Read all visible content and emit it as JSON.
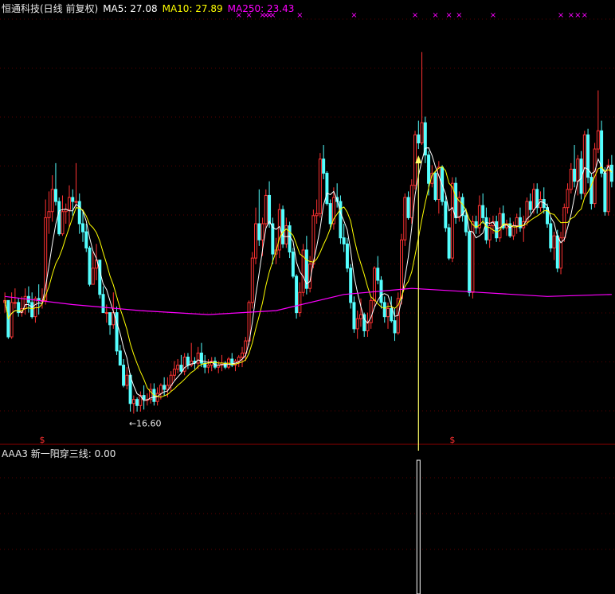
{
  "header": {
    "stock_label": "恒通科技(日线 前复权)",
    "ma5": "MA5: 27.08",
    "ma10": "MA10: 27.89",
    "ma250": "MA250: 23.43"
  },
  "indicator_panel": {
    "label": "AAA3",
    "signal_text": "新一阳穿三线: 0.00"
  },
  "colors": {
    "up": "#ff3232",
    "down": "#54ffff",
    "ma5": "#ffffff",
    "ma10": "#ffff00",
    "ma250": "#ff00ff",
    "signal_arrow": "#ffff66",
    "grid": "#8b0000"
  },
  "chart_data": {
    "type": "candlestick",
    "low_annotation": "16.60",
    "top_markers": "×",
    "bottom_markers": "$",
    "candles": [
      [
        22.1,
        22.6,
        21.6,
        22.2
      ],
      [
        22.2,
        22.2,
        20.3,
        20.4
      ],
      [
        20.4,
        22.6,
        20.3,
        22.1
      ],
      [
        22.1,
        22.8,
        21.8,
        22.1
      ],
      [
        22.1,
        22.3,
        21.4,
        21.6
      ],
      [
        21.6,
        22.4,
        21.4,
        21.8
      ],
      [
        21.8,
        22.8,
        21.5,
        22.4
      ],
      [
        22.4,
        22.9,
        21.6,
        22.1
      ],
      [
        22.1,
        22.6,
        21.3,
        21.4
      ],
      [
        21.4,
        22.4,
        21.1,
        22.3
      ],
      [
        22.3,
        23.0,
        21.5,
        22.2
      ],
      [
        22.2,
        22.8,
        21.8,
        22.2
      ],
      [
        22.2,
        27.2,
        22.0,
        26.3
      ],
      [
        26.3,
        27.6,
        25.5,
        26.6
      ],
      [
        26.6,
        28.4,
        26.1,
        27.7
      ],
      [
        27.7,
        29.0,
        26.9,
        27.1
      ],
      [
        27.1,
        27.3,
        25.4,
        25.5
      ],
      [
        25.5,
        27.4,
        25.4,
        26.6
      ],
      [
        26.6,
        27.0,
        26.0,
        26.7
      ],
      [
        26.7,
        27.9,
        25.8,
        27.3
      ],
      [
        27.3,
        27.7,
        26.4,
        27.1
      ],
      [
        27.1,
        29.0,
        26.8,
        27.1
      ],
      [
        27.1,
        27.5,
        25.5,
        26.0
      ],
      [
        26.0,
        26.7,
        25.1,
        25.6
      ],
      [
        25.6,
        26.0,
        24.6,
        24.8
      ],
      [
        24.8,
        24.9,
        22.9,
        23.0
      ],
      [
        23.0,
        24.6,
        23.0,
        23.8
      ],
      [
        23.8,
        25.0,
        23.2,
        24.2
      ],
      [
        24.2,
        24.2,
        22.3,
        22.5
      ],
      [
        22.5,
        22.9,
        21.6,
        21.6
      ],
      [
        21.6,
        22.0,
        21.1,
        21.6
      ],
      [
        21.6,
        21.6,
        20.5,
        21.0
      ],
      [
        21.0,
        22.6,
        20.8,
        21.6
      ],
      [
        21.6,
        21.9,
        19.5,
        19.7
      ],
      [
        19.7,
        20.0,
        19.0,
        19.0
      ],
      [
        19.0,
        19.3,
        17.9,
        18.0
      ],
      [
        18.0,
        18.9,
        17.8,
        18.5
      ],
      [
        18.5,
        18.6,
        16.7,
        17.1
      ],
      [
        17.1,
        17.5,
        16.6,
        17.3
      ],
      [
        17.3,
        17.4,
        16.7,
        17.0
      ],
      [
        17.0,
        17.7,
        16.7,
        17.5
      ],
      [
        17.5,
        18.0,
        16.8,
        17.3
      ],
      [
        17.3,
        17.6,
        17.0,
        17.3
      ],
      [
        17.3,
        18.1,
        17.1,
        17.8
      ],
      [
        17.8,
        18.1,
        17.0,
        17.2
      ],
      [
        17.2,
        17.9,
        17.0,
        17.6
      ],
      [
        17.6,
        18.1,
        17.3,
        18.0
      ],
      [
        18.0,
        18.4,
        17.5,
        17.8
      ],
      [
        17.8,
        18.4,
        17.4,
        18.0
      ],
      [
        18.0,
        18.7,
        17.7,
        18.5
      ],
      [
        18.5,
        19.2,
        18.2,
        18.8
      ],
      [
        18.8,
        19.3,
        18.6,
        19.0
      ],
      [
        19.0,
        19.5,
        18.6,
        18.7
      ],
      [
        18.7,
        19.6,
        18.5,
        19.4
      ],
      [
        19.4,
        19.6,
        18.8,
        19.0
      ],
      [
        19.0,
        20.1,
        18.9,
        19.2
      ],
      [
        19.2,
        19.4,
        18.8,
        19.1
      ],
      [
        19.1,
        19.9,
        18.8,
        19.6
      ],
      [
        19.6,
        20.1,
        18.9,
        19.1
      ],
      [
        19.1,
        19.5,
        18.6,
        18.9
      ],
      [
        18.9,
        19.3,
        18.6,
        19.0
      ],
      [
        19.0,
        19.4,
        18.7,
        19.2
      ],
      [
        19.2,
        19.4,
        18.8,
        18.9
      ],
      [
        18.9,
        19.2,
        18.6,
        19.0
      ],
      [
        19.0,
        19.5,
        18.7,
        19.1
      ],
      [
        19.1,
        19.2,
        18.8,
        18.9
      ],
      [
        18.9,
        19.4,
        18.8,
        19.3
      ],
      [
        19.3,
        19.6,
        18.9,
        19.0
      ],
      [
        19.0,
        19.3,
        18.7,
        19.2
      ],
      [
        19.2,
        19.5,
        18.9,
        19.4
      ],
      [
        19.4,
        19.9,
        18.9,
        19.6
      ],
      [
        19.6,
        20.4,
        19.2,
        20.2
      ],
      [
        20.2,
        22.2,
        20.0,
        22.1
      ],
      [
        22.1,
        24.6,
        21.8,
        24.3
      ],
      [
        24.3,
        26.8,
        24.0,
        26.0
      ],
      [
        26.0,
        27.7,
        24.9,
        25.2
      ],
      [
        25.2,
        26.3,
        24.4,
        26.0
      ],
      [
        26.0,
        27.7,
        25.8,
        27.4
      ],
      [
        27.4,
        28.1,
        25.8,
        26.0
      ],
      [
        26.0,
        26.3,
        24.0,
        24.5
      ],
      [
        24.5,
        25.3,
        24.0,
        24.7
      ],
      [
        24.7,
        27.0,
        24.3,
        26.7
      ],
      [
        26.7,
        26.9,
        24.8,
        25.0
      ],
      [
        25.0,
        26.3,
        24.8,
        25.9
      ],
      [
        25.9,
        26.1,
        24.3,
        24.6
      ],
      [
        24.6,
        24.8,
        23.3,
        23.4
      ],
      [
        23.4,
        23.5,
        21.3,
        21.6
      ],
      [
        21.6,
        23.1,
        21.4,
        22.6
      ],
      [
        22.6,
        25.0,
        22.4,
        24.7
      ],
      [
        24.7,
        25.4,
        22.5,
        22.8
      ],
      [
        22.8,
        24.4,
        22.6,
        24.0
      ],
      [
        24.0,
        26.7,
        23.8,
        26.4
      ],
      [
        26.4,
        27.2,
        26.0,
        26.5
      ],
      [
        26.5,
        29.5,
        26.3,
        29.2
      ],
      [
        29.2,
        29.9,
        28.2,
        28.5
      ],
      [
        28.5,
        28.6,
        26.9,
        27.0
      ],
      [
        27.0,
        27.2,
        25.7,
        26.0
      ],
      [
        26.0,
        27.8,
        25.7,
        27.3
      ],
      [
        27.3,
        28.0,
        26.8,
        27.1
      ],
      [
        27.1,
        27.4,
        25.0,
        25.3
      ],
      [
        25.3,
        26.0,
        24.6,
        25.0
      ],
      [
        25.0,
        25.3,
        23.6,
        23.8
      ],
      [
        23.8,
        24.0,
        21.8,
        22.1
      ],
      [
        22.1,
        22.4,
        20.6,
        20.8
      ],
      [
        20.8,
        21.7,
        20.3,
        21.3
      ],
      [
        21.3,
        22.3,
        20.9,
        21.5
      ],
      [
        21.5,
        21.6,
        20.4,
        20.7
      ],
      [
        20.7,
        21.6,
        20.4,
        21.1
      ],
      [
        21.1,
        22.4,
        20.8,
        22.2
      ],
      [
        22.2,
        23.9,
        21.9,
        23.8
      ],
      [
        23.8,
        24.4,
        23.0,
        23.2
      ],
      [
        23.2,
        23.4,
        21.8,
        22.1
      ],
      [
        22.1,
        22.4,
        21.1,
        21.4
      ],
      [
        21.4,
        22.1,
        20.8,
        21.8
      ],
      [
        21.8,
        22.4,
        21.1,
        21.2
      ],
      [
        21.2,
        21.8,
        20.2,
        20.6
      ],
      [
        20.6,
        22.6,
        20.5,
        22.3
      ],
      [
        22.3,
        25.5,
        22.0,
        25.2
      ],
      [
        25.2,
        27.5,
        24.9,
        27.3
      ],
      [
        27.3,
        27.6,
        26.2,
        26.3
      ],
      [
        26.3,
        28.2,
        26.0,
        27.9
      ],
      [
        27.9,
        30.6,
        27.7,
        30.4
      ],
      [
        30.4,
        31.1,
        29.7,
        30.0
      ],
      [
        30.0,
        34.5,
        29.9,
        31.0
      ],
      [
        31.0,
        31.3,
        29.0,
        29.4
      ],
      [
        29.4,
        29.6,
        27.4,
        28.0
      ],
      [
        28.0,
        28.9,
        27.8,
        28.5
      ],
      [
        28.5,
        28.6,
        27.1,
        27.2
      ],
      [
        27.2,
        29.1,
        26.5,
        28.8
      ],
      [
        28.8,
        28.9,
        26.9,
        27.1
      ],
      [
        27.1,
        27.4,
        25.6,
        25.8
      ],
      [
        25.8,
        26.0,
        24.2,
        24.3
      ],
      [
        24.3,
        28.3,
        24.1,
        28.0
      ],
      [
        28.0,
        28.3,
        26.0,
        26.3
      ],
      [
        26.3,
        27.6,
        26.1,
        27.3
      ],
      [
        27.3,
        27.5,
        26.1,
        26.4
      ],
      [
        26.4,
        26.7,
        25.4,
        25.6
      ],
      [
        25.6,
        25.7,
        22.4,
        22.6
      ],
      [
        22.6,
        26.4,
        22.3,
        26.1
      ],
      [
        26.1,
        26.4,
        25.5,
        25.8
      ],
      [
        25.8,
        27.4,
        25.5,
        26.9
      ],
      [
        26.9,
        27.5,
        26.0,
        26.3
      ],
      [
        26.3,
        26.8,
        25.0,
        25.2
      ],
      [
        25.2,
        26.3,
        24.8,
        25.9
      ],
      [
        25.9,
        26.4,
        25.5,
        26.1
      ],
      [
        26.1,
        26.4,
        25.1,
        25.3
      ],
      [
        25.3,
        26.8,
        25.1,
        26.5
      ],
      [
        26.5,
        26.9,
        25.7,
        25.8
      ],
      [
        25.8,
        26.2,
        25.4,
        26.0
      ],
      [
        26.0,
        26.3,
        25.3,
        25.4
      ],
      [
        25.4,
        26.1,
        25.2,
        25.9
      ],
      [
        25.9,
        26.5,
        25.5,
        26.3
      ],
      [
        26.3,
        26.8,
        25.6,
        25.8
      ],
      [
        25.8,
        26.4,
        25.1,
        26.1
      ],
      [
        26.1,
        27.3,
        25.9,
        27.1
      ],
      [
        27.1,
        27.5,
        26.5,
        26.7
      ],
      [
        26.7,
        28.0,
        26.5,
        27.7
      ],
      [
        27.7,
        28.0,
        26.5,
        26.8
      ],
      [
        26.8,
        27.6,
        26.6,
        27.2
      ],
      [
        27.2,
        27.8,
        26.5,
        26.8
      ],
      [
        26.8,
        27.0,
        25.8,
        26.0
      ],
      [
        26.0,
        26.3,
        24.6,
        24.8
      ],
      [
        24.8,
        25.6,
        24.2,
        25.4
      ],
      [
        25.4,
        25.7,
        23.6,
        23.8
      ],
      [
        23.8,
        25.6,
        23.5,
        25.3
      ],
      [
        25.3,
        27.0,
        25.1,
        26.8
      ],
      [
        26.8,
        28.0,
        26.5,
        27.7
      ],
      [
        27.7,
        29.0,
        27.5,
        28.7
      ],
      [
        28.7,
        29.9,
        27.8,
        28.1
      ],
      [
        28.1,
        29.4,
        27.4,
        29.2
      ],
      [
        29.2,
        29.6,
        27.2,
        27.5
      ],
      [
        27.5,
        30.6,
        27.3,
        30.4
      ],
      [
        30.4,
        30.7,
        28.0,
        28.3
      ],
      [
        28.3,
        28.5,
        26.7,
        27.0
      ],
      [
        27.0,
        30.0,
        26.8,
        29.7
      ],
      [
        29.7,
        32.6,
        29.5,
        30.6
      ],
      [
        30.6,
        31.1,
        28.3,
        28.5
      ],
      [
        28.5,
        28.8,
        26.4,
        26.6
      ],
      [
        26.6,
        29.2,
        26.4,
        28.9
      ],
      [
        28.9,
        29.4,
        27.8,
        28.1
      ]
    ],
    "ma250_points": [
      [
        0,
        22.4
      ],
      [
        20,
        22.0
      ],
      [
        40,
        21.7
      ],
      [
        60,
        21.5
      ],
      [
        80,
        21.7
      ],
      [
        100,
        22.5
      ],
      [
        120,
        22.8
      ],
      [
        140,
        22.6
      ],
      [
        160,
        22.4
      ],
      [
        179,
        22.5
      ]
    ],
    "signal_index": 122,
    "low_index": 38,
    "bottom_marker_indices": [
      11,
      132
    ],
    "top_marker_indices": [
      69,
      72,
      76,
      77,
      78,
      79,
      87,
      103,
      121,
      127,
      131,
      134,
      144,
      164,
      167,
      169,
      171
    ]
  }
}
